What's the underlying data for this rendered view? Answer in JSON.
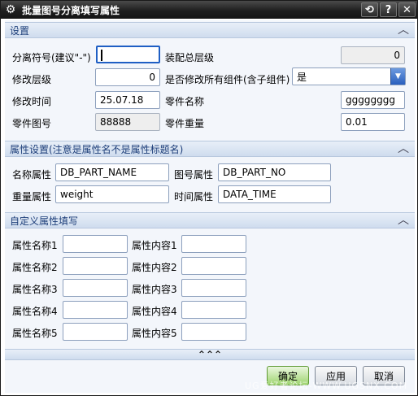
{
  "window": {
    "title": "批量图号分离填写属性",
    "buttons": {
      "reset": "⟲",
      "help": "?",
      "close": "✕"
    }
  },
  "section_settings": {
    "title": "设置",
    "separator_label": "分离符号(建议\"-\")",
    "separator_value": "",
    "assembly_level_label": "装配总层级",
    "assembly_level_value": "0",
    "modify_level_label": "修改层级",
    "modify_level_value": "0",
    "modify_all_label": "是否修改所有组件(含子组件)",
    "modify_all_value": "是",
    "modify_time_label": "修改时间",
    "modify_time_value": "25.07.18",
    "part_name_label": "零件名称",
    "part_name_value": "gggggggg",
    "part_number_label": "零件图号",
    "part_number_value": "88888",
    "part_weight_label": "零件重量",
    "part_weight_value": "0.01"
  },
  "section_attr": {
    "title": "属性设置(注意是属性名不是属性标题名)",
    "name_attr_label": "名称属性",
    "name_attr_value": "DB_PART_NAME",
    "number_attr_label": "图号属性",
    "number_attr_value": "DB_PART_NO",
    "weight_attr_label": "重量属性",
    "weight_attr_value": "weight",
    "time_attr_label": "时间属性",
    "time_attr_value": "DATA_TIME"
  },
  "section_custom": {
    "title": "自定义属性填写",
    "rows": [
      {
        "name_label": "属性名称1",
        "content_label": "属性内容1",
        "name_value": "",
        "content_value": ""
      },
      {
        "name_label": "属性名称2",
        "content_label": "属性内容2",
        "name_value": "",
        "content_value": ""
      },
      {
        "name_label": "属性名称3",
        "content_label": "属性内容3",
        "name_value": "",
        "content_value": ""
      },
      {
        "name_label": "属性名称4",
        "content_label": "属性内容4",
        "name_value": "",
        "content_value": ""
      },
      {
        "name_label": "属性名称5",
        "content_label": "属性内容5",
        "name_value": "",
        "content_value": ""
      }
    ]
  },
  "expand_label": "⌃⌃⌃",
  "footer": {
    "ok": "确定",
    "apply": "应用",
    "cancel": "取消"
  },
  "watermark": "UG爱好者论坛-WWW.UGSNX.COM",
  "colors": {
    "section_title": "#1e3f7a",
    "ok_button": "#9ed46f",
    "dropdown_arrow": "#2a5fbd"
  }
}
